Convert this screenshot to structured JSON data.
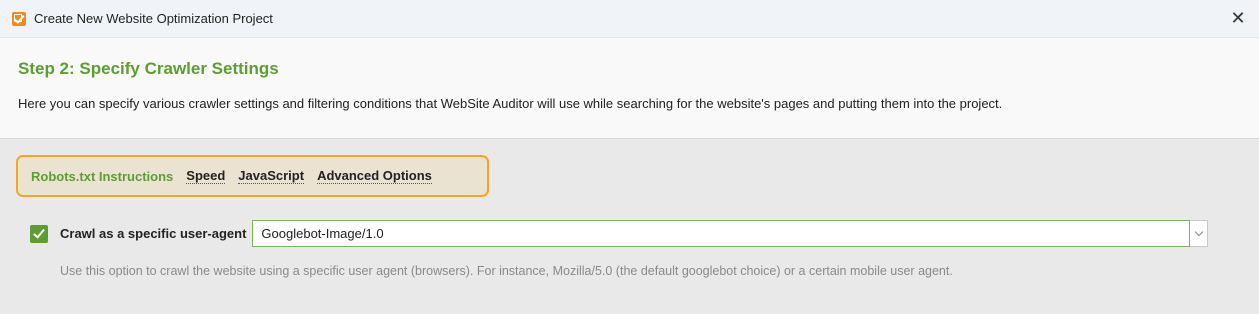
{
  "window": {
    "title": "Create New Website Optimization Project",
    "close_label": "✕"
  },
  "header": {
    "step_title": "Step 2: Specify Crawler Settings",
    "description": "Here you can specify various crawler settings and filtering conditions that WebSite Auditor will use while searching for the website's pages and putting them into the project."
  },
  "tabs": [
    {
      "label": "Robots.txt Instructions",
      "active": true
    },
    {
      "label": "Speed",
      "active": false
    },
    {
      "label": "JavaScript",
      "active": false
    },
    {
      "label": "Advanced Options",
      "active": false
    }
  ],
  "user_agent": {
    "checked": true,
    "label": "Crawl as a specific user-agent",
    "value": "Googlebot-Image/1.0",
    "hint": "Use this option to crawl the website using a specific user agent (browsers). For instance, Mozilla/5.0 (the default googlebot choice) or a certain mobile user agent."
  },
  "colors": {
    "accent_green": "#5c9e31",
    "highlight_orange": "#f5a524"
  }
}
